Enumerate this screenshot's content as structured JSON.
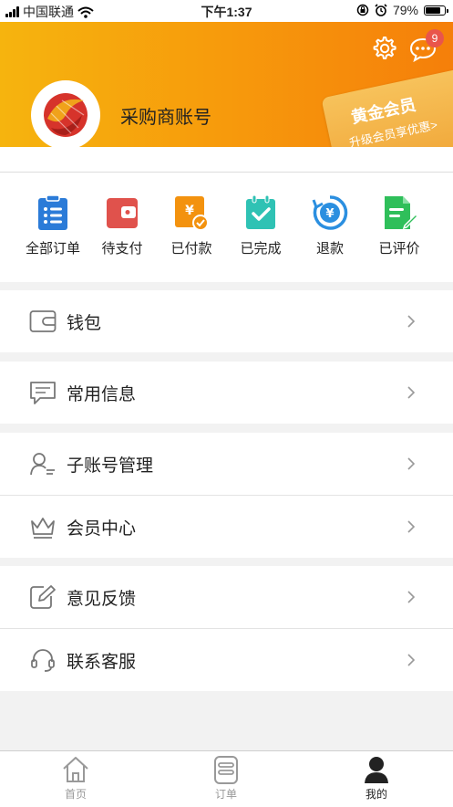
{
  "status_bar": {
    "carrier": "中国联通",
    "time": "下午1:37",
    "battery": "79%",
    "battery_level": 0.79
  },
  "header": {
    "settings_icon": "gear-icon",
    "messages_icon": "chat-bubble-icon",
    "message_badge": "9",
    "account_name": "采购商账号",
    "vip_card": {
      "title": "黄金会员",
      "subtitle": "升级会员享优惠>"
    },
    "colors": {
      "gradient_start": "#f6b40e",
      "gradient_end": "#f57f0a"
    }
  },
  "orders": [
    {
      "label": "全部订单",
      "icon": "clipboard-list-icon",
      "color": "#2b7bd8"
    },
    {
      "label": "待支付",
      "icon": "wallet-icon",
      "color": "#e0524c"
    },
    {
      "label": "已付款",
      "icon": "yen-paid-icon",
      "color": "#f3920e"
    },
    {
      "label": "已完成",
      "icon": "check-calendar-icon",
      "color": "#2fc2b4"
    },
    {
      "label": "退款",
      "icon": "refund-yen-icon",
      "color": "#2b8fe0"
    },
    {
      "label": "已评价",
      "icon": "review-doc-icon",
      "color": "#2fbf5a"
    }
  ],
  "menu": {
    "wallet": "钱包",
    "common_info": "常用信息",
    "sub_account": "子账号管理",
    "member_center": "会员中心",
    "feedback": "意见反馈",
    "customer_service": "联系客服"
  },
  "tabbar": {
    "home": "首页",
    "orders": "订单",
    "mine": "我的"
  }
}
